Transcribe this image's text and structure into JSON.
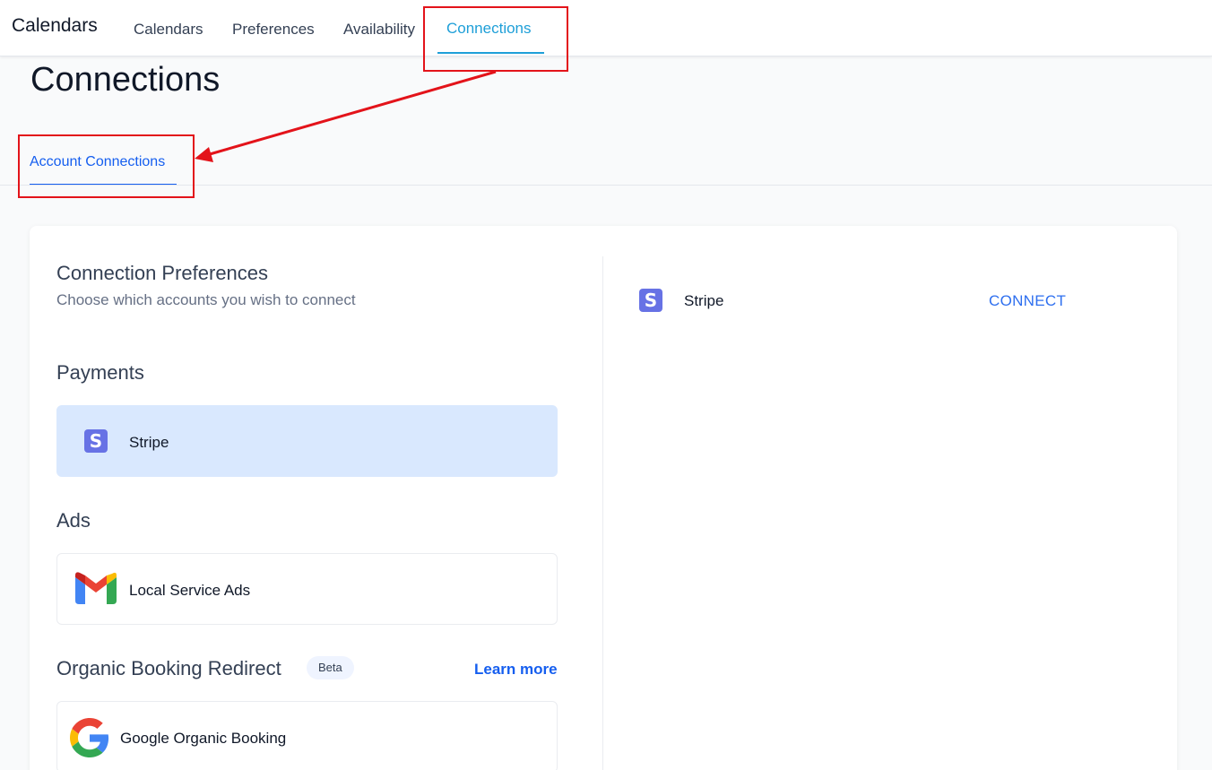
{
  "header": {
    "app_title": "Calendars",
    "tabs": [
      {
        "label": "Calendars"
      },
      {
        "label": "Preferences"
      },
      {
        "label": "Availability"
      },
      {
        "label": "Connections",
        "active": true
      }
    ]
  },
  "page": {
    "title": "Connections",
    "subtab": "Account Connections"
  },
  "preferences": {
    "title": "Connection Preferences",
    "subtitle": "Choose which accounts you wish to connect",
    "sections": [
      {
        "title": "Payments",
        "items": [
          {
            "label": "Stripe",
            "icon": "stripe-icon",
            "selected": true
          }
        ]
      },
      {
        "title": "Ads",
        "items": [
          {
            "label": "Local Service Ads",
            "icon": "gmail-icon",
            "selected": false
          }
        ]
      },
      {
        "title": "Organic Booking Redirect",
        "badge": "Beta",
        "link": "Learn more",
        "items": [
          {
            "label": "Google Organic Booking",
            "icon": "google-icon",
            "selected": false
          }
        ]
      }
    ]
  },
  "detail": {
    "label": "Stripe",
    "icon": "stripe-icon",
    "connect_label": "CONNECT"
  },
  "icon_glyphs": {
    "stripe": "S"
  },
  "colors": {
    "active_tab": "#1e9fd8",
    "link": "#155eef",
    "selected_bg": "#d9e8fe",
    "stripe": "#6772e5",
    "annotation": "#e3131a"
  }
}
